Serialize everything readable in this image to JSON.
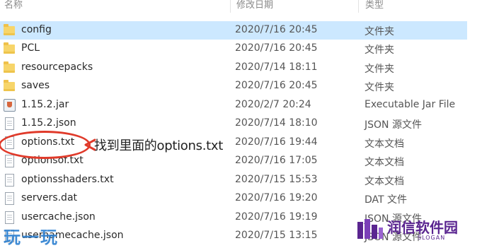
{
  "header": {
    "name": "名称",
    "date": "修改日期",
    "type": "类型"
  },
  "files": [
    {
      "name": "config",
      "date": "2020/7/16 20:45",
      "type": "文件夹",
      "icon": "folder-icon"
    },
    {
      "name": "PCL",
      "date": "2020/7/16 20:45",
      "type": "文件夹",
      "icon": "folder-icon"
    },
    {
      "name": "resourcepacks",
      "date": "2020/7/14 18:11",
      "type": "文件夹",
      "icon": "folder-icon"
    },
    {
      "name": "saves",
      "date": "2020/7/16 20:45",
      "type": "文件夹",
      "icon": "folder-icon"
    },
    {
      "name": "1.15.2.jar",
      "date": "2020/2/7 20:24",
      "type": "Executable Jar File",
      "icon": "jar-icon"
    },
    {
      "name": "1.15.2.json",
      "date": "2020/7/14 18:10",
      "type": "JSON 源文件",
      "icon": "document-icon"
    },
    {
      "name": "options.txt",
      "date": "2020/7/16 19:44",
      "type": "文本文档",
      "icon": "document-icon"
    },
    {
      "name": "optionsof.txt",
      "date": "2020/7/16 17:05",
      "type": "文本文档",
      "icon": "document-icon"
    },
    {
      "name": "optionsshaders.txt",
      "date": "2020/7/15 15:53",
      "type": "文本文档",
      "icon": "document-icon"
    },
    {
      "name": "servers.dat",
      "date": "2020/7/16 19:20",
      "type": "DAT 文件",
      "icon": "document-icon"
    },
    {
      "name": "usercache.json",
      "date": "2020/7/16 19:19",
      "type": "JSON 源文件",
      "icon": "document-icon"
    },
    {
      "name": "usernamecache.json",
      "date": "2020/7/15 13:15",
      "type": "JSON 源文件",
      "icon": "document-icon"
    }
  ],
  "annotation": {
    "text": "找到里面的options.txt",
    "color": "#e03a2a"
  },
  "watermarks": {
    "left": "玩一玩",
    "right": "润信软件园",
    "right_slogan": "SLOGAN"
  },
  "colors": {
    "selection": "#cce8ff",
    "folder": "#f7d56a",
    "brand": "#5a2590"
  }
}
